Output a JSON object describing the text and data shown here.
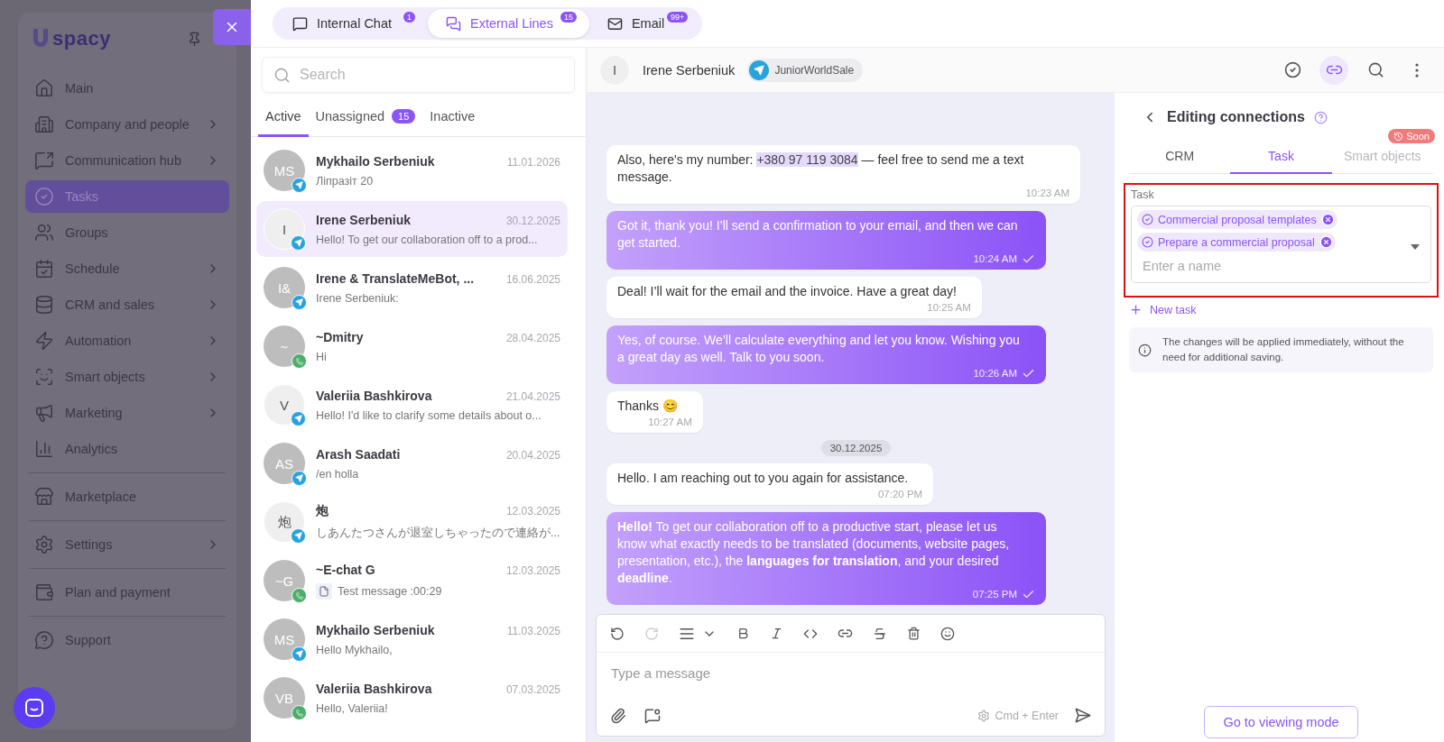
{
  "sidebar": {
    "logo": "spacy",
    "nav_groups": [
      [
        {
          "label": "Main",
          "has_submenu": false,
          "selected": false
        },
        {
          "label": "Company and people",
          "has_submenu": true,
          "selected": false
        },
        {
          "label": "Communication hub",
          "has_submenu": true,
          "selected": false
        },
        {
          "label": "Tasks",
          "has_submenu": false,
          "selected": true
        },
        {
          "label": "Groups",
          "has_submenu": false,
          "selected": false
        },
        {
          "label": "Schedule",
          "has_submenu": true,
          "selected": false
        },
        {
          "label": "CRM and sales",
          "has_submenu": true,
          "selected": false
        },
        {
          "label": "Automation",
          "has_submenu": true,
          "selected": false
        },
        {
          "label": "Smart objects",
          "has_submenu": true,
          "selected": false
        },
        {
          "label": "Marketing",
          "has_submenu": true,
          "selected": false
        },
        {
          "label": "Analytics",
          "has_submenu": false,
          "selected": false
        }
      ],
      [
        {
          "label": "Marketplace",
          "has_submenu": false,
          "selected": false
        }
      ],
      [
        {
          "label": "Settings",
          "has_submenu": true,
          "selected": false
        }
      ],
      [
        {
          "label": "Plan and payment",
          "has_submenu": false,
          "selected": false
        }
      ],
      [
        {
          "label": "Support",
          "has_submenu": false,
          "selected": false
        }
      ]
    ]
  },
  "top_tabs": [
    {
      "label": "Internal Chat",
      "badge": "1",
      "selected": false
    },
    {
      "label": "External Lines",
      "badge": "15",
      "selected": true
    },
    {
      "label": "Email",
      "badge": "99+",
      "selected": false
    }
  ],
  "chat_list": {
    "search": {
      "placeholder": "Search"
    },
    "tabs": [
      {
        "label": "Active",
        "selected": true
      },
      {
        "label": "Unassigned",
        "badge": "15",
        "selected": false
      },
      {
        "label": "Inactive",
        "selected": false
      }
    ],
    "conversations": [
      {
        "initials": "MS",
        "avatar_light": false,
        "kind": "telegram",
        "name": "Mykhailo Serbeniuk",
        "date": "11.01.2026",
        "preview": "Ліпразіт 20",
        "attachment": false,
        "selected": false
      },
      {
        "initials": "I",
        "avatar_light": true,
        "kind": "telegram",
        "name": "Irene Serbeniuk",
        "date": "30.12.2025",
        "preview": "Hello! To get our collaboration off to a prod...",
        "attachment": false,
        "selected": true
      },
      {
        "initials": "I&",
        "avatar_light": false,
        "kind": "telegram",
        "name": "Irene & TranslateMeBot, ...",
        "date": "16.06.2025",
        "preview": "Irene Serbeniuk:",
        "attachment": false,
        "selected": false
      },
      {
        "initials": "~",
        "avatar_light": false,
        "kind": "whatsapp",
        "name": "~Dmitry",
        "date": "28.04.2025",
        "preview": "Hi",
        "attachment": false,
        "selected": false
      },
      {
        "initials": "V",
        "avatar_light": true,
        "kind": "telegram",
        "name": "Valeriia Bashkirova",
        "date": "21.04.2025",
        "preview": "Hello! I'd like to clarify some details about o...",
        "attachment": false,
        "selected": false
      },
      {
        "initials": "AS",
        "avatar_light": false,
        "kind": "telegram",
        "name": "Arash Saadati",
        "date": "20.04.2025",
        "preview": "/en holla",
        "attachment": false,
        "selected": false
      },
      {
        "initials": "炮",
        "avatar_light": true,
        "kind": "telegram",
        "name": "炮",
        "date": "12.03.2025",
        "preview": "しあんたつさんが退室しちゃったので連絡が...",
        "attachment": false,
        "selected": false
      },
      {
        "initials": "~G",
        "avatar_light": false,
        "kind": "whatsapp",
        "name": "~E-chat G",
        "date": "12.03.2025",
        "preview": "Test message :00:29",
        "attachment": true,
        "selected": false
      },
      {
        "initials": "MS",
        "avatar_light": false,
        "kind": "telegram",
        "name": "Mykhailo Serbeniuk",
        "date": "11.03.2025",
        "preview": "Hello Mykhailo,",
        "attachment": false,
        "selected": false
      },
      {
        "initials": "VB",
        "avatar_light": false,
        "kind": "whatsapp",
        "name": "Valeriia Bashkirova",
        "date": "07.03.2025",
        "preview": "Hello, Valeriia!",
        "attachment": false,
        "selected": false
      }
    ]
  },
  "chat": {
    "avatar": "I",
    "name": "Irene Serbeniuk",
    "kind": "telegram",
    "channel_label": "JuniorWorldSale",
    "header_actions": [
      {
        "selected": false
      },
      {
        "selected": true
      },
      {
        "selected": false
      },
      {
        "selected": false
      }
    ],
    "messages": [
      {
        "kind": "incoming",
        "parts": [
          {
            "text": "Also, here's my number: ",
            "highlight": false
          },
          {
            "text": "+380 97 119 3084",
            "highlight": true
          },
          {
            "text": " — feel free to send me a text message.",
            "highlight": false
          }
        ],
        "time": "10:23 AM"
      },
      {
        "kind": "outgoing",
        "text": "Got it, thank you! I’ll send a confirmation to your email, and then we can get started.",
        "time": "10:24 AM",
        "sent": true
      },
      {
        "kind": "incoming",
        "text": "Deal! I’ll wait for the email and the invoice. Have a great day!",
        "time": "10:25 AM"
      },
      {
        "kind": "outgoing",
        "text": "Yes, of course. We’ll calculate everything and let you know. Wishing you a great day as well. Talk to you soon.",
        "time": "10:26 AM",
        "sent": true
      },
      {
        "kind": "incoming",
        "text": "Thanks 😊",
        "time": "10:27 AM"
      },
      {
        "kind": "date",
        "text": "30.12.2025"
      },
      {
        "kind": "incoming",
        "text": "Hello. I am reaching out to you again for assistance.",
        "time": "07:20 PM"
      },
      {
        "kind": "outgoing",
        "text": "**Hello!** To get our collaboration off to a productive start, please let us know what exactly needs to be translated (documents, website pages, presentation, etc.), the **languages for translation**, and your desired **deadline**.",
        "time": "07:25 PM",
        "sent": true
      }
    ],
    "composer": {
      "placeholder": "Type a message",
      "shortcut": "Cmd + Enter"
    }
  },
  "connections": {
    "title": "Editing connections",
    "tabs": [
      {
        "label": "CRM",
        "selected": false,
        "disabled": false
      },
      {
        "label": "Task",
        "selected": true,
        "disabled": false
      },
      {
        "label": "Smart objects",
        "selected": false,
        "disabled": true,
        "badge": "Soon"
      }
    ],
    "field": {
      "label": "Task",
      "chips": [
        "Commercial proposal templates",
        "Prepare a commercial proposal"
      ],
      "placeholder": "Enter a name",
      "highlighted": true
    },
    "new_task": "New task",
    "note": "The changes will be applied immediately, without the need for additional saving.",
    "button": "Go to viewing mode"
  }
}
